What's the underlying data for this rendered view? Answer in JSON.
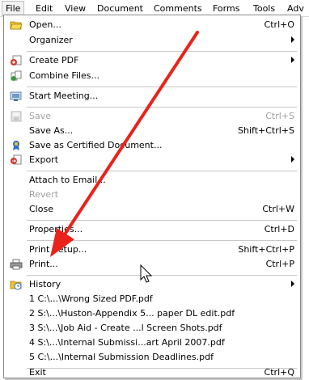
{
  "menubar": {
    "items": [
      "File",
      "Edit",
      "View",
      "Document",
      "Comments",
      "Forms",
      "Tools",
      "Adv"
    ]
  },
  "file_menu": {
    "items": [
      {
        "label": "Open...",
        "shortcut": "Ctrl+O",
        "icon": "open-folder-icon"
      },
      {
        "label": "Organizer",
        "submenu": true
      },
      {
        "label": "Create PDF",
        "submenu": true,
        "icon": "create-pdf-icon"
      },
      {
        "label": "Combine Files...",
        "icon": "combine-files-icon"
      },
      {
        "label": "Start Meeting...",
        "icon": "meeting-icon"
      },
      {
        "label": "Save",
        "shortcut": "Ctrl+S",
        "disabled": true,
        "icon": "save-icon"
      },
      {
        "label": "Save As...",
        "shortcut": "Shift+Ctrl+S"
      },
      {
        "label": "Save as Certified Document...",
        "icon": "certified-icon"
      },
      {
        "label": "Export",
        "submenu": true,
        "icon": "export-icon"
      },
      {
        "label": "Attach to Email..."
      },
      {
        "label": "Revert",
        "disabled": true
      },
      {
        "label": "Close",
        "shortcut": "Ctrl+W"
      },
      {
        "label": "Properties...",
        "shortcut": "Ctrl+D"
      },
      {
        "label": "Print Setup...",
        "shortcut": "Shift+Ctrl+P"
      },
      {
        "label": "Print...",
        "shortcut": "Ctrl+P",
        "icon": "printer-icon"
      },
      {
        "label": "History",
        "submenu": true,
        "icon": "history-icon"
      },
      {
        "label": "1 C:\\...\\Wrong Sized PDF.pdf"
      },
      {
        "label": "2 S:\\...\\Huston-Appendix 5... paper DL edit.pdf"
      },
      {
        "label": "3 S:\\...\\Job Aid - Create ...l Screen Shots.pdf"
      },
      {
        "label": "4 S:\\...\\Internal Submissi...art April 2007.pdf"
      },
      {
        "label": "5 C:\\...\\Internal Submission Deadlines.pdf"
      },
      {
        "label": "Exit",
        "shortcut": "Ctrl+Q"
      }
    ]
  },
  "colors": {
    "arrow": "#e8231b",
    "disabled_text": "#a0a0a0"
  }
}
